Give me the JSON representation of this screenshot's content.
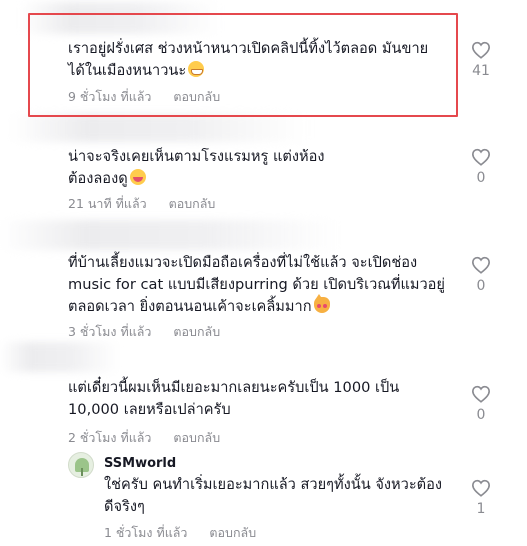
{
  "comments": [
    {
      "text_line1": "เราอยู่ฝรั่งเศส ช่วงหน้าหนาวเปิดคลิปนี้ทิ้งไว้ตลอด มันขาย",
      "text_line2": "ได้ในเมืองหนาวนะ",
      "emoji": "grinning-face-emoji",
      "time": "9 ชั่วโมง ที่แล้ว",
      "reply_label": "ตอบกลับ",
      "likes": "41",
      "highlighted": true
    },
    {
      "text_line1": "น่าจะจริงเคยเห็นตามโรงแรมหรู แต่งห้อง",
      "text_line2": "ต้องลองดู",
      "emoji": "laughing-face-emoji",
      "time": "21 นาที ที่แล้ว",
      "reply_label": "ตอบกลับ",
      "likes": "0"
    },
    {
      "text_line1": "ที่บ้านเลี้ยงแมวจะเปิดมือถือเครื่องที่ไม่ใช้แล้ว จะเปิดช่อง",
      "text_line2": "music for cat แบบมีเสียงpurring ด้วย เปิดบริเวณที่แมวอยู่",
      "text_line3": "ตลอดเวลา ยิ่งตอนนอนเค้าจะเคลิ้มมาก",
      "emoji": "cat-face-emoji",
      "time": "3 ชั่วโมง ที่แล้ว",
      "reply_label": "ตอบกลับ",
      "likes": "0"
    },
    {
      "text_line1": "แต่เดี๋ยวนี้ผมเห็นมีเยอะมากเลยนะครับเป็น 1000 เป็น",
      "text_line2": "10,000 เลยหรือเปล่าครับ",
      "time": "2 ชั่วโมง ที่แล้ว",
      "reply_label": "ตอบกลับ",
      "likes": "0"
    }
  ],
  "reply": {
    "username": "SSMworld",
    "text_line1": "ใช่ครับ คนทำเริ่มเยอะมากแล้ว สวยๆทั้งนั้น จังหวะต้อง",
    "text_line2": "ดีจริงๆ",
    "time": "1 ชั่วโมง ที่แล้ว",
    "reply_label": "ตอบกลับ",
    "likes": "1"
  },
  "icons": {
    "like": "heart-outline-icon",
    "avatar": "ssmworld-avatar"
  },
  "colors": {
    "highlight": "#e5484d",
    "meta": "#8a8b91",
    "text": "#161823"
  }
}
